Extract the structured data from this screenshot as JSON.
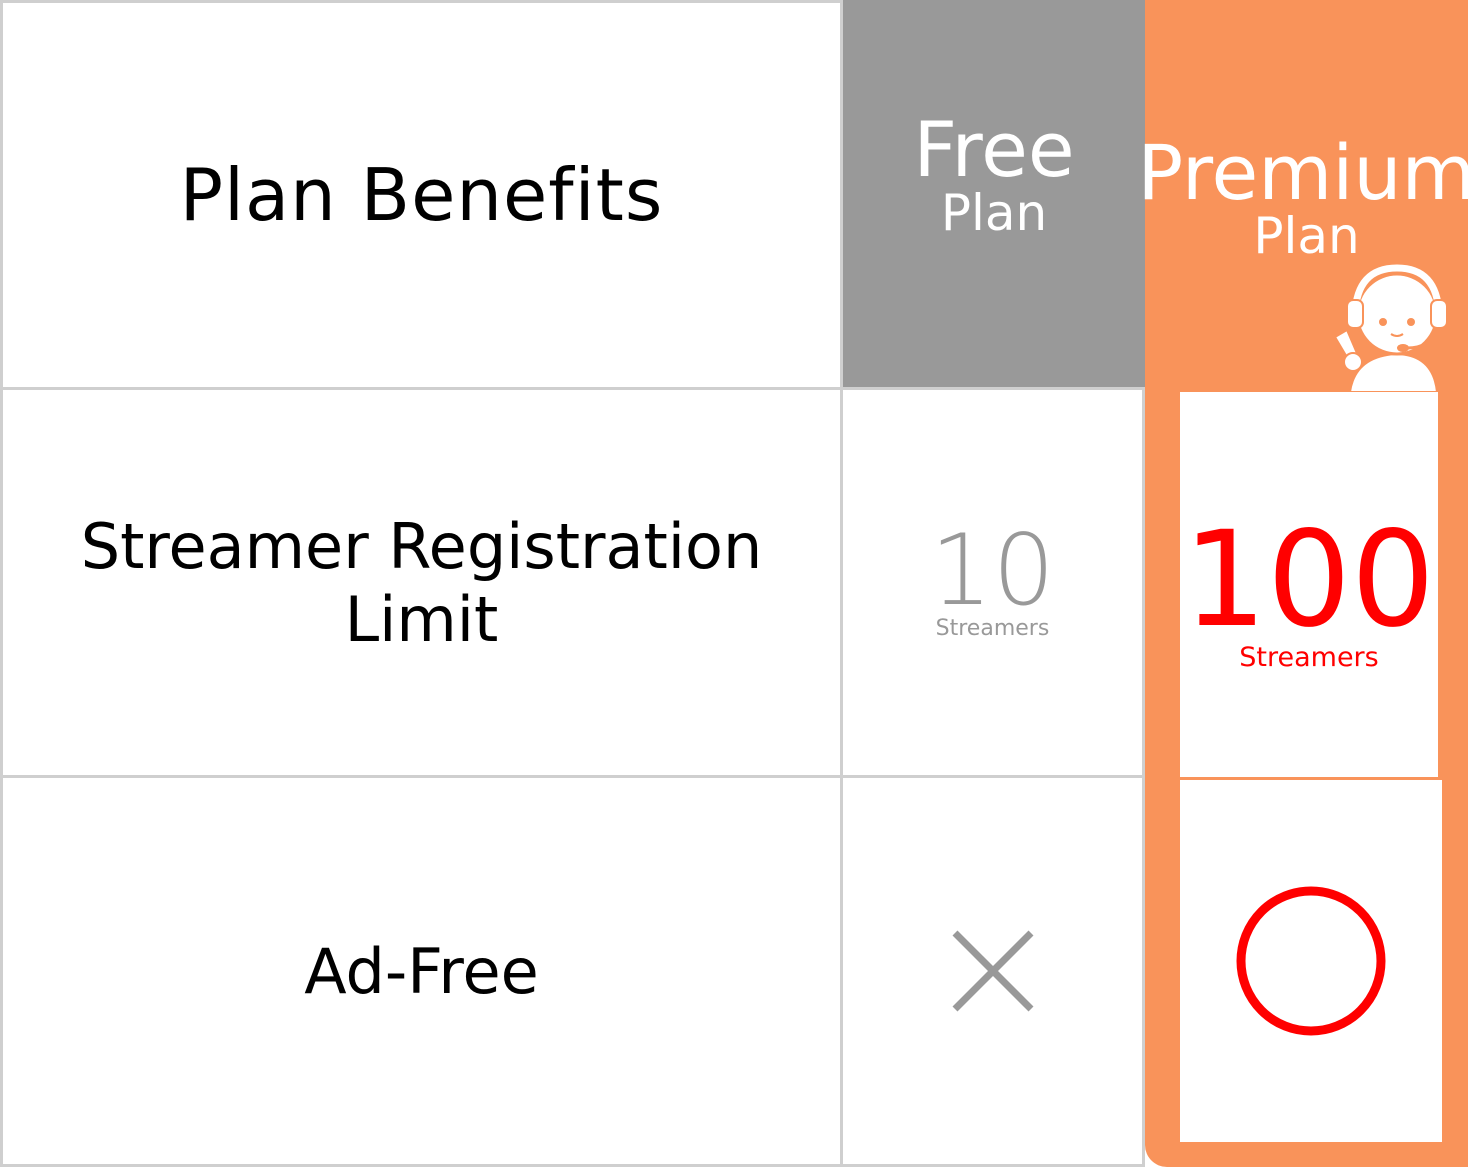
{
  "header": {
    "title": "Plan Benefits",
    "free_plan_main": "Free",
    "free_plan_sub": "Plan",
    "premium_plan_main": "Premium",
    "premium_plan_sub": "Plan"
  },
  "rows": [
    {
      "feature": "Streamer Registration Limit",
      "free_value": "10",
      "free_unit": "Streamers",
      "premium_value": "100",
      "premium_unit": "Streamers"
    },
    {
      "feature": "Ad-Free",
      "free_value": "×",
      "premium_value": "○"
    }
  ],
  "colors": {
    "free_header": "#999999",
    "premium_accent": "#f9935a",
    "premium_value": "#ff0000",
    "grid_border": "#cfcfcf"
  },
  "icons": {
    "mascot": "support-operator-icon",
    "not_available": "cross-icon",
    "available": "circle-icon"
  }
}
